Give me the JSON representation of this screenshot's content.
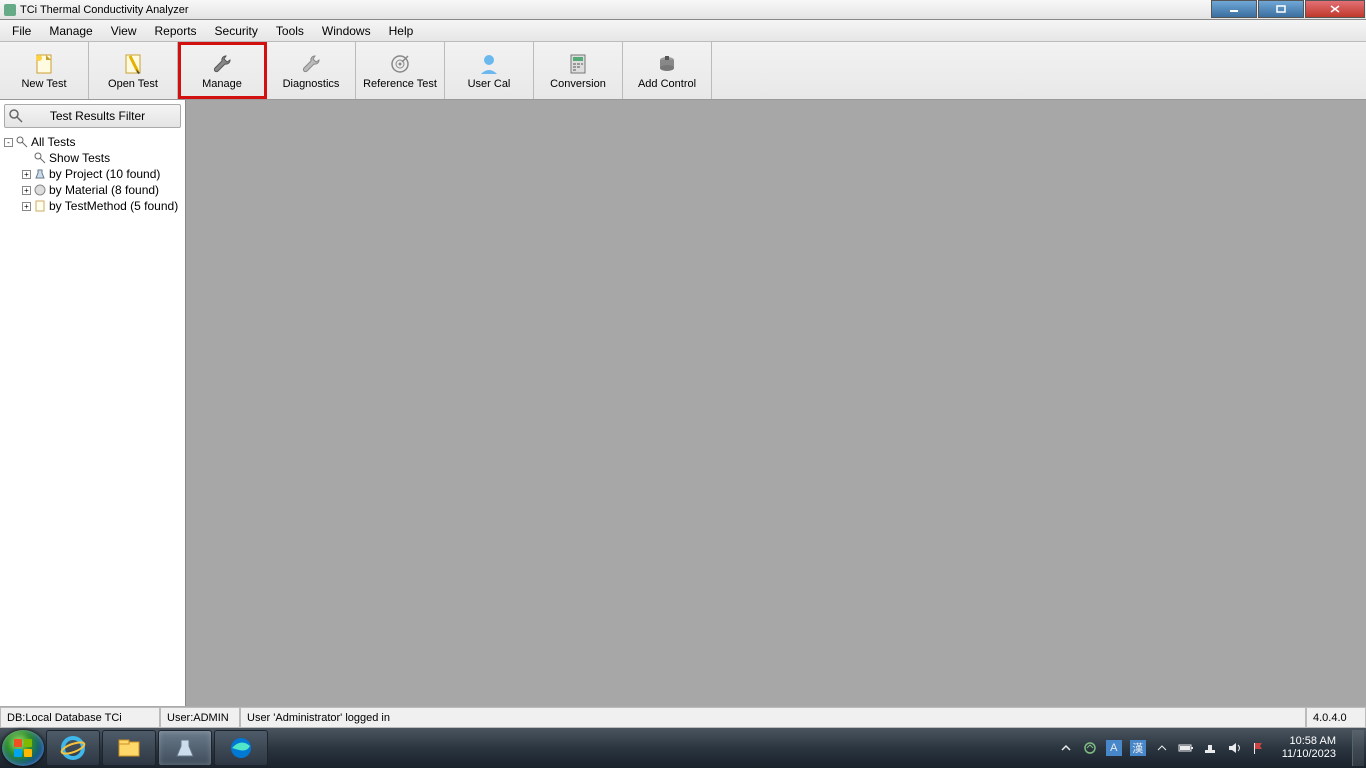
{
  "window": {
    "title": "TCi Thermal Conductivity Analyzer"
  },
  "menu": {
    "items": [
      "File",
      "Manage",
      "View",
      "Reports",
      "Security",
      "Tools",
      "Windows",
      "Help"
    ]
  },
  "toolbar": {
    "buttons": [
      {
        "label": "New Test",
        "icon": "new-test-icon"
      },
      {
        "label": "Open Test",
        "icon": "open-test-icon"
      },
      {
        "label": "Manage",
        "icon": "wrench-icon",
        "highlighted": true
      },
      {
        "label": "Diagnostics",
        "icon": "diagnostics-icon"
      },
      {
        "label": "Reference Test",
        "icon": "target-icon"
      },
      {
        "label": "User Cal",
        "icon": "user-icon"
      },
      {
        "label": "Conversion",
        "icon": "calculator-icon"
      },
      {
        "label": "Add Control",
        "icon": "control-icon"
      }
    ]
  },
  "sidebar": {
    "filter_label": "Test Results Filter",
    "root": {
      "label": "All Tests"
    },
    "children": [
      {
        "label": "Show Tests"
      },
      {
        "label": "by Project (10 found)"
      },
      {
        "label": "by Material (8 found)"
      },
      {
        "label": "by TestMethod (5 found)"
      }
    ]
  },
  "statusbar": {
    "db": "DB:Local Database TCi",
    "user": "User:ADMIN",
    "message": "User 'Administrator' logged in",
    "version": "4.0.4.0"
  },
  "taskbar": {
    "time": "10:58 AM",
    "date": "11/10/2023",
    "ime": "漢"
  }
}
